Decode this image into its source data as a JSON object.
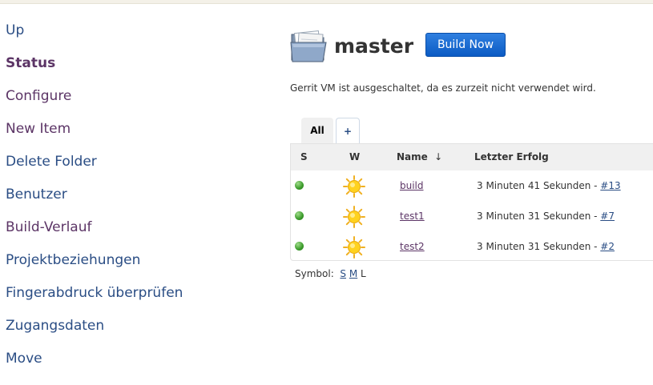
{
  "sidebar": {
    "items": [
      {
        "label": "Up"
      },
      {
        "label": "Status"
      },
      {
        "label": "Configure"
      },
      {
        "label": "New Item"
      },
      {
        "label": "Delete Folder"
      },
      {
        "label": "Benutzer"
      },
      {
        "label": "Build-Verlauf"
      },
      {
        "label": "Projektbeziehungen"
      },
      {
        "label": "Fingerabdruck überprüfen"
      },
      {
        "label": "Zugangsdaten"
      },
      {
        "label": "Move"
      }
    ]
  },
  "header": {
    "icon": "folder-icon",
    "title": "master",
    "build_button": "Build Now"
  },
  "notice": "Gerrit VM ist ausgeschaltet, da es zurzeit nicht verwendet wird.",
  "tabs": [
    {
      "label": "All"
    },
    {
      "label": "+"
    }
  ],
  "table": {
    "columns": [
      "S",
      "W",
      "Name",
      "↓",
      "Letzter Erfolg"
    ],
    "rows": [
      {
        "status": "green-ball-icon",
        "weather": "sun-icon",
        "name": "build",
        "last_success": "3 Minuten 41 Sekunden - ",
        "build": "#13"
      },
      {
        "status": "green-ball-icon",
        "weather": "sun-icon",
        "name": "test1",
        "last_success": "3 Minuten 31 Sekunden - ",
        "build": "#7"
      },
      {
        "status": "green-ball-icon",
        "weather": "sun-icon",
        "name": "test2",
        "last_success": "3 Minuten 31 Sekunden - ",
        "build": "#2"
      }
    ]
  },
  "symbol": {
    "label": "Symbol:",
    "sizes": [
      "S",
      "M",
      "L"
    ]
  },
  "colors": {
    "link": "#2a4d84",
    "visited": "#5c3566",
    "button": "#0b5bc4"
  }
}
